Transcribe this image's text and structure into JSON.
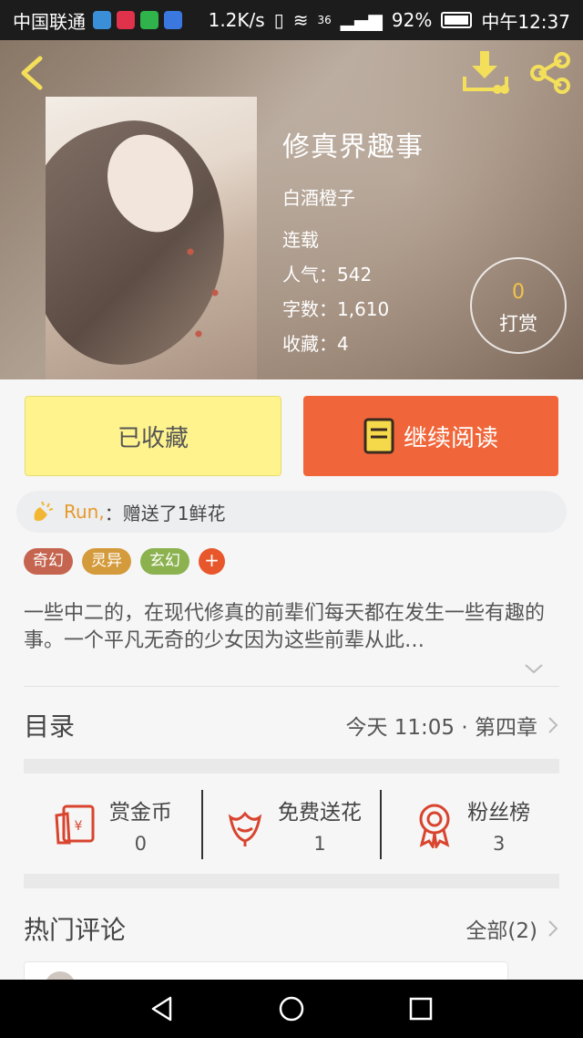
{
  "status_bar": {
    "carrier": "中国联通",
    "speed": "1.2K/s",
    "network": "36",
    "battery": "92%",
    "time": "中午12:37"
  },
  "book": {
    "title": "修真界趣事",
    "author": "白酒橙子",
    "status": "连载",
    "stats": [
      {
        "label": "人气：",
        "value": "542"
      },
      {
        "label": "字数：",
        "value": "1,610"
      },
      {
        "label": "收藏：",
        "value": "4"
      }
    ],
    "tip": {
      "count": "0",
      "label": "打赏"
    }
  },
  "actions": {
    "collected_label": "已收藏",
    "continue_label": "继续阅读"
  },
  "gift_notice": {
    "user": "Run,",
    "text": "：赠送了1鲜花"
  },
  "tags": [
    {
      "label": "奇幻",
      "color": "#c5654f"
    },
    {
      "label": "灵异",
      "color": "#d49b3c"
    },
    {
      "label": "玄幻",
      "color": "#8cb250"
    }
  ],
  "tag_add": "+",
  "description": "一些中二的，在现代修真的前辈们每天都在发生一些有趣的事。一个平凡无奇的少女因为这些前辈从此…",
  "toc": {
    "title": "目录",
    "latest": "今天 11:05 · 第四章"
  },
  "support": [
    {
      "label": "赏金币",
      "value": "0",
      "icon": "red-envelope-icon"
    },
    {
      "label": "免费送花",
      "value": "1",
      "icon": "flower-icon"
    },
    {
      "label": "粉丝榜",
      "value": "3",
      "icon": "medal-icon"
    }
  ],
  "comments": {
    "title": "热门评论",
    "all_label": "全部(2)"
  },
  "colors": {
    "accent_orange": "#f0663a",
    "collected_yellow": "#fef38d",
    "icon_red": "#d8442e",
    "header_icon_yellow": "#f3df5a"
  }
}
